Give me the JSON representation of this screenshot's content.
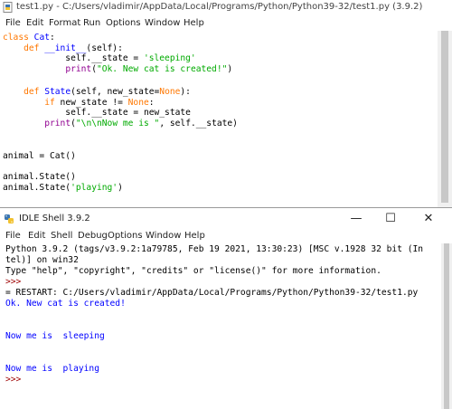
{
  "editor": {
    "title": "test1.py - C:/Users/vladimir/AppData/Local/Programs/Python/Python39-32/test1.py (3.9.2)",
    "menu": [
      "File",
      "Edit",
      "Format",
      "Run",
      "Options",
      "Window",
      "Help"
    ],
    "code": {
      "l1_kw": "class",
      "l1_name": " Cat",
      "l1_rest": ":",
      "l2_kw": "    def",
      "l2_name": " __init__",
      "l2_rest": "(self):",
      "l3_pre": "            self.__state = ",
      "l3_str": "'sleeping'",
      "l4_pre": "            ",
      "l4_bi": "print",
      "l4_open": "(",
      "l4_str": "\"Ok. New cat is created!\"",
      "l4_close": ")",
      "l5_kw": "    def",
      "l5_name": " State",
      "l5_rest1": "(self, new_state=",
      "l5_none": "None",
      "l5_rest2": "):",
      "l6_pre": "        ",
      "l6_kw": "if",
      "l6_mid": " new_state != ",
      "l6_none": "None",
      "l6_end": ":",
      "l7": "            self.__state = new_state",
      "l8_pre": "        ",
      "l8_bi": "print",
      "l8_open": "(",
      "l8_str": "\"\\n\\nNow me is \"",
      "l8_rest": ", self.__state)",
      "l9": "animal = Cat()",
      "l10": "animal.State()",
      "l11_pre": "animal.State(",
      "l11_str": "'playing'",
      "l11_end": ")"
    }
  },
  "shell": {
    "title": "IDLE Shell 3.9.2",
    "buttons": {
      "minimize": "—",
      "maximize": "☐",
      "close": "✕"
    },
    "menu": [
      "File",
      "Edit",
      "Shell",
      "Debug",
      "Options",
      "Window",
      "Help"
    ],
    "lines": {
      "banner1": "Python 3.9.2 (tags/v3.9.2:1a79785, Feb 19 2021, 13:30:23) [MSC v.1928 32 bit (In",
      "banner2": "tel)] on win32",
      "banner3": "Type \"help\", \"copyright\", \"credits\" or \"license()\" for more information.",
      "prompt1": ">>>",
      "restart": "= RESTART: C:/Users/vladimir/AppData/Local/Programs/Python/Python39-32/test1.py",
      "out1": "Ok. New cat is created!",
      "out2": "Now me is  sleeping",
      "out3": "Now me is  playing",
      "prompt2": ">>>"
    }
  }
}
